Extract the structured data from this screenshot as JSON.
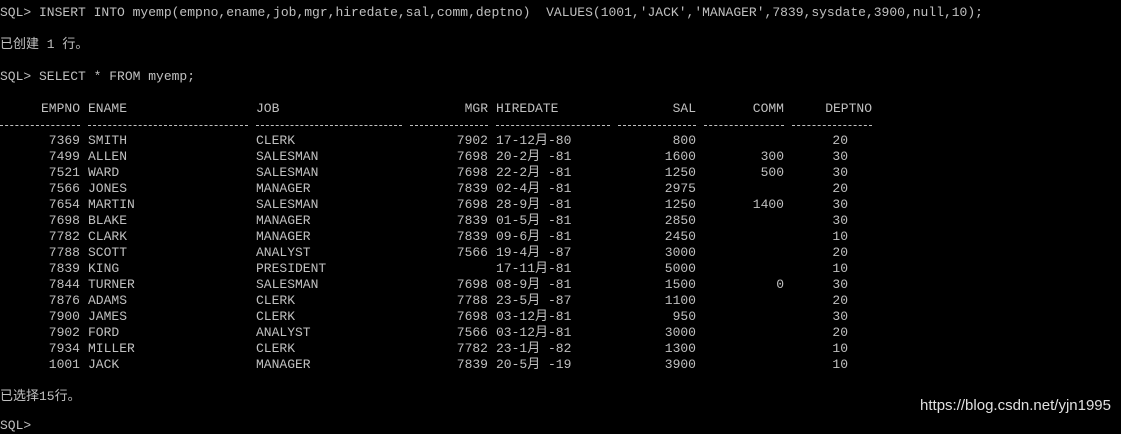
{
  "console": {
    "insert_cmd": "SQL> INSERT INTO myemp(empno,ename,job,mgr,hiredate,sal,comm,deptno)  VALUES(1001,'JACK','MANAGER',7839,sysdate,3900,null,10);",
    "insert_result": "已创建 1 行。",
    "select_cmd": "SQL> SELECT * FROM myemp;",
    "footer": "已选择15行。",
    "next_prompt": "SQL>"
  },
  "table": {
    "headers": [
      "EMPNO",
      "ENAME",
      "JOB",
      "MGR",
      "HIREDATE",
      "SAL",
      "COMM",
      "DEPTNO"
    ],
    "rows": [
      [
        "7369",
        "SMITH",
        "CLERK",
        "7902",
        "17-12月-80",
        "800",
        "",
        "20"
      ],
      [
        "7499",
        "ALLEN",
        "SALESMAN",
        "7698",
        "20-2月 -81",
        "1600",
        "300",
        "30"
      ],
      [
        "7521",
        "WARD",
        "SALESMAN",
        "7698",
        "22-2月 -81",
        "1250",
        "500",
        "30"
      ],
      [
        "7566",
        "JONES",
        "MANAGER",
        "7839",
        "02-4月 -81",
        "2975",
        "",
        "20"
      ],
      [
        "7654",
        "MARTIN",
        "SALESMAN",
        "7698",
        "28-9月 -81",
        "1250",
        "1400",
        "30"
      ],
      [
        "7698",
        "BLAKE",
        "MANAGER",
        "7839",
        "01-5月 -81",
        "2850",
        "",
        "30"
      ],
      [
        "7782",
        "CLARK",
        "MANAGER",
        "7839",
        "09-6月 -81",
        "2450",
        "",
        "10"
      ],
      [
        "7788",
        "SCOTT",
        "ANALYST",
        "7566",
        "19-4月 -87",
        "3000",
        "",
        "20"
      ],
      [
        "7839",
        "KING",
        "PRESIDENT",
        "",
        "17-11月-81",
        "5000",
        "",
        "10"
      ],
      [
        "7844",
        "TURNER",
        "SALESMAN",
        "7698",
        "08-9月 -81",
        "1500",
        "0",
        "30"
      ],
      [
        "7876",
        "ADAMS",
        "CLERK",
        "7788",
        "23-5月 -87",
        "1100",
        "",
        "20"
      ],
      [
        "7900",
        "JAMES",
        "CLERK",
        "7698",
        "03-12月-81",
        "950",
        "",
        "30"
      ],
      [
        "7902",
        "FORD",
        "ANALYST",
        "7566",
        "03-12月-81",
        "3000",
        "",
        "20"
      ],
      [
        "7934",
        "MILLER",
        "CLERK",
        "7782",
        "23-1月 -82",
        "1300",
        "",
        "10"
      ],
      [
        "1001",
        "JACK",
        "MANAGER",
        "7839",
        "20-5月 -19",
        "3900",
        "",
        "10"
      ]
    ]
  },
  "watermark": "https://blog.csdn.net/yjn1995",
  "colors": {
    "background": "#000000",
    "text": "#c0c0c0"
  }
}
